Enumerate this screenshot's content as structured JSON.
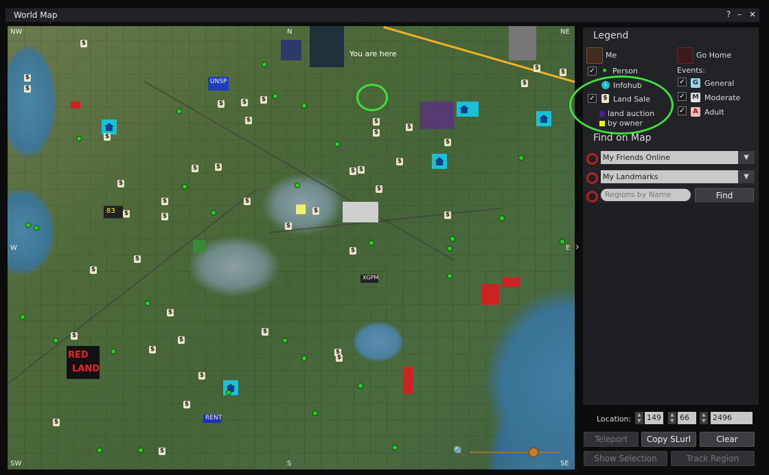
{
  "window": {
    "title": "World Map",
    "help": "?",
    "minimize": "–",
    "close": "✕"
  },
  "map": {
    "compass": {
      "nw": "NW",
      "n": "N",
      "ne": "NE",
      "w": "W",
      "e": "E",
      "sw": "SW",
      "s": "S",
      "se": "SE"
    },
    "you_are_here": "You are here",
    "land_sale_glyph": "$",
    "visible_sign_text": [
      "UNSP",
      "RED",
      "LAND",
      "RENT",
      "XGPM",
      "83"
    ],
    "zoom_level": 0.7
  },
  "legend": {
    "title": "Legend",
    "me": "Me",
    "go_home": "Go Home",
    "person": "Person",
    "infohub": "Infohub",
    "land_sale": "Land Sale",
    "land_auction": "land auction",
    "by_owner": "by owner",
    "events_label": "Events:",
    "events": [
      {
        "badge": "G",
        "label": "General",
        "color": "#9fd4e6"
      },
      {
        "badge": "M",
        "label": "Moderate",
        "color": "#e2e2e2"
      },
      {
        "badge": "A",
        "label": "Adult",
        "color": "#f2b8b8"
      }
    ],
    "colors": {
      "person": "#29d11f",
      "infohub": "#19c1d6",
      "auction": "#4b1f8a",
      "by_owner": "#f0f000",
      "highlight": "#3fe03a"
    }
  },
  "find": {
    "title": "Find on Map",
    "friends": "My Friends Online",
    "landmarks": "My Landmarks",
    "regions_placeholder": "Regions by Name",
    "find_button": "Find"
  },
  "location": {
    "label": "Location:",
    "x": "149",
    "y": "66",
    "z": "2496"
  },
  "buttons": {
    "teleport": "Teleport",
    "copy_slurl": "Copy SLurl",
    "clear": "Clear",
    "show_selection": "Show Selection",
    "track_region": "Track Region"
  }
}
